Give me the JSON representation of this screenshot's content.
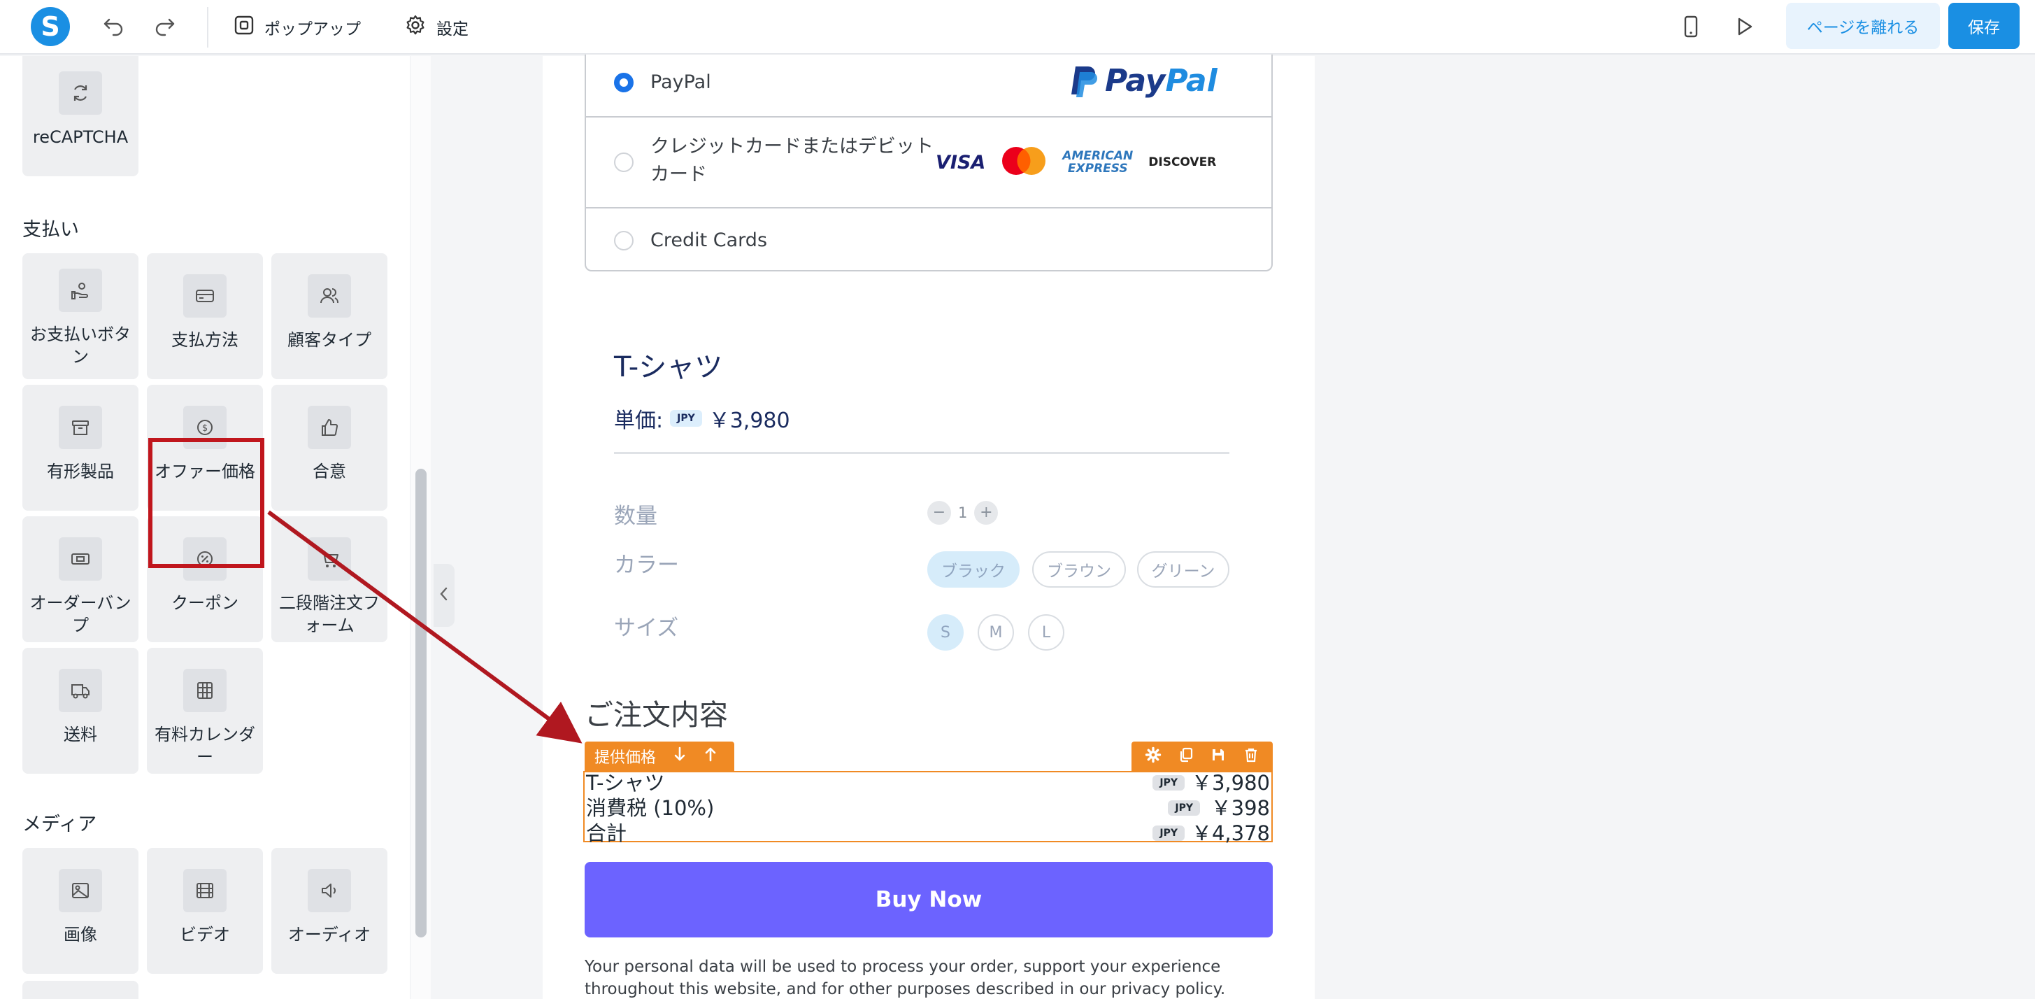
{
  "topbar": {
    "logo_letter": "S",
    "popup_label": "ポップアップ",
    "settings_label": "設定",
    "leave_label": "ページを離れる",
    "save_label": "保存"
  },
  "sidebar": {
    "recaptcha_label": "reCAPTCHA",
    "payments_title": "支払い",
    "payment_tiles": [
      {
        "label": "お支払いボタン",
        "icon": "hand-coins-icon"
      },
      {
        "label": "支払方法",
        "icon": "credit-card-icon"
      },
      {
        "label": "顧客タイプ",
        "icon": "users-icon"
      },
      {
        "label": "有形製品",
        "icon": "archive-box-icon"
      },
      {
        "label": "オファー価格",
        "icon": "dollar-circle-icon"
      },
      {
        "label": "合意",
        "icon": "thumbs-up-icon"
      },
      {
        "label": "オーダーバンプ",
        "icon": "ticket-icon"
      },
      {
        "label": "クーポン",
        "icon": "percent-badge-icon"
      },
      {
        "label": "二段階注文フォーム",
        "icon": "cart-icon"
      },
      {
        "label": "送料",
        "icon": "truck-icon"
      },
      {
        "label": "有料カレンダー",
        "icon": "calendar-grid-icon"
      }
    ],
    "media_title": "メディア",
    "media_tiles": [
      {
        "label": "画像",
        "icon": "image-icon"
      },
      {
        "label": "ビデオ",
        "icon": "film-icon"
      },
      {
        "label": "オーディオ",
        "icon": "speaker-icon"
      }
    ]
  },
  "payment_methods": {
    "options": [
      {
        "label": "PayPal",
        "selected": true
      },
      {
        "label": "クレジットカードまたはデビット",
        "label_line2": "カード",
        "selected": false
      },
      {
        "label": "Credit Cards",
        "selected": false
      }
    ],
    "paypal_logo": {
      "pay": "Pay",
      "pal": "Pal"
    },
    "card_brands": [
      "VISA",
      "AMERICAN",
      "EXPRESS",
      "DISCOVER"
    ]
  },
  "product": {
    "title": "T-シャツ",
    "unit_price_label": "単価:",
    "currency_badge": "JPY",
    "unit_price": "￥3,980",
    "quantity_label": "数量",
    "quantity_value": "1",
    "color_label": "カラー",
    "colors": [
      "ブラック",
      "ブラウン",
      "グリーン"
    ],
    "selected_color": "ブラック",
    "size_label": "サイズ",
    "sizes": [
      "S",
      "M",
      "L"
    ],
    "selected_size": "S"
  },
  "order_summary": {
    "title": "ご注文内容",
    "toolbar_label": "提供価格",
    "rows": [
      {
        "name": "T-シャツ",
        "currency": "JPY",
        "price": "￥3,980"
      },
      {
        "name": "消費税 (10%)",
        "currency": "JPY",
        "price": "￥398"
      },
      {
        "name": "合計",
        "currency": "JPY",
        "price": "￥4,378"
      }
    ]
  },
  "buy_button_label": "Buy Now",
  "privacy_text": "Your personal data will be used to process your order, support your experience throughout this website, and for other purposes described in our privacy policy.",
  "colors": {
    "brand_blue": "#1a8fe3",
    "highlight_red": "#c0161d",
    "builder_orange": "#f08a24",
    "buy_purple": "#6c63ff"
  }
}
